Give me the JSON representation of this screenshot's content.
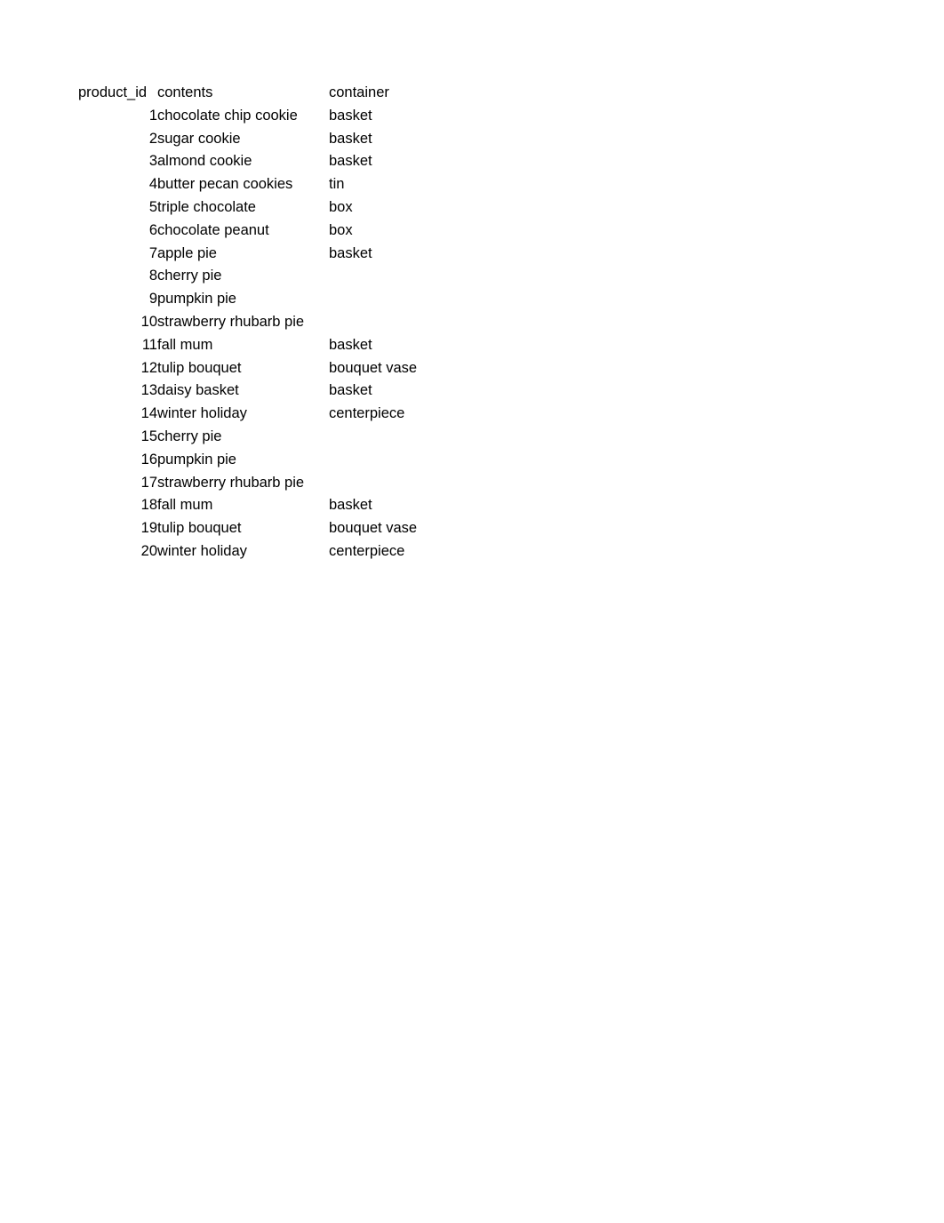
{
  "document": {
    "type": "spreadsheet-data-table",
    "background_color": "#ffffff",
    "text_color": "#000000"
  },
  "table": {
    "headers": {
      "product_id": "product_id",
      "contents": "contents",
      "container": "container"
    },
    "rows": [
      {
        "product_id": "1",
        "contents": "chocolate chip cookie",
        "container": "basket"
      },
      {
        "product_id": "2",
        "contents": "sugar cookie",
        "container": "basket"
      },
      {
        "product_id": "3",
        "contents": "almond cookie",
        "container": "basket"
      },
      {
        "product_id": "4",
        "contents": "butter pecan cookies",
        "container": "tin"
      },
      {
        "product_id": "5",
        "contents": "triple chocolate",
        "container": "box"
      },
      {
        "product_id": "6",
        "contents": "chocolate peanut",
        "container": "box"
      },
      {
        "product_id": "7",
        "contents": "apple pie",
        "container": "basket"
      },
      {
        "product_id": "8",
        "contents": "cherry pie",
        "container": ""
      },
      {
        "product_id": "9",
        "contents": "pumpkin pie",
        "container": ""
      },
      {
        "product_id": "10",
        "contents": "strawberry rhubarb pie",
        "container": ""
      },
      {
        "product_id": "11",
        "contents": "fall mum",
        "container": "basket"
      },
      {
        "product_id": "12",
        "contents": "tulip bouquet",
        "container": "bouquet vase"
      },
      {
        "product_id": "13",
        "contents": "daisy basket",
        "container": "basket"
      },
      {
        "product_id": "14",
        "contents": "winter holiday",
        "container": "centerpiece"
      },
      {
        "product_id": "15",
        "contents": "cherry pie",
        "container": ""
      },
      {
        "product_id": "16",
        "contents": "pumpkin pie",
        "container": ""
      },
      {
        "product_id": "17",
        "contents": "strawberry rhubarb pie",
        "container": ""
      },
      {
        "product_id": "18",
        "contents": "fall mum",
        "container": "basket"
      },
      {
        "product_id": "19",
        "contents": "tulip bouquet",
        "container": "bouquet vase"
      },
      {
        "product_id": "20",
        "contents": "winter holiday",
        "container": "centerpiece"
      }
    ]
  }
}
